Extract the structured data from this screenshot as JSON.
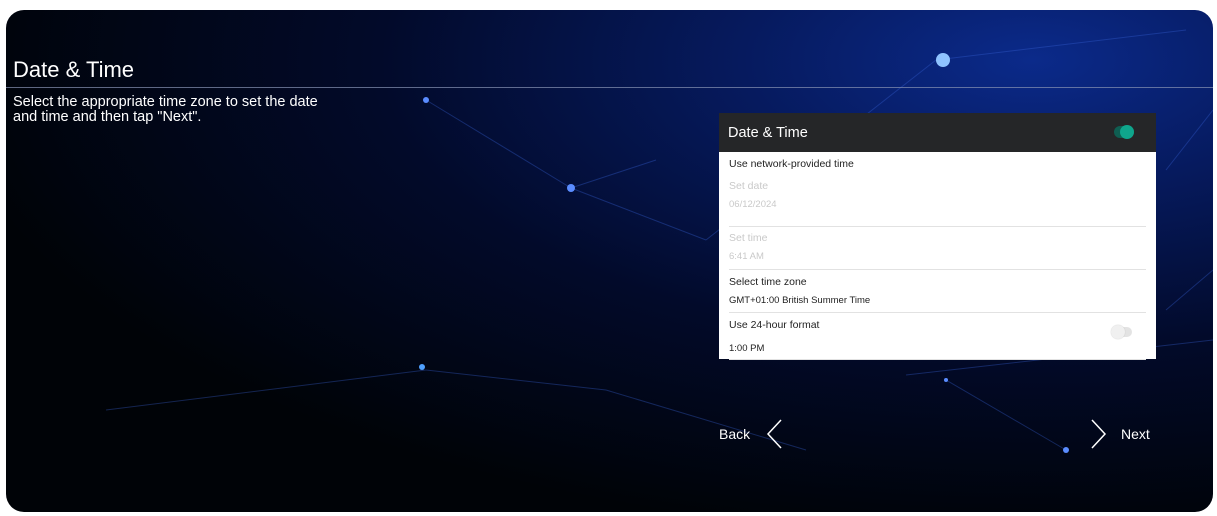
{
  "page": {
    "title": "Date & Time",
    "instructions": "Select the appropriate time zone to set the date and time and then tap \"Next\"."
  },
  "panel": {
    "title": "Date & Time",
    "header_toggle_on": true,
    "network_time": {
      "label": "Use network-provided time"
    },
    "set_date": {
      "label": "Set date",
      "value": "06/12/2024",
      "enabled": false
    },
    "set_time": {
      "label": "Set time",
      "value": "6:41 AM",
      "enabled": false
    },
    "time_zone": {
      "label": "Select time zone",
      "value": "GMT+01:00 British Summer Time"
    },
    "hour24": {
      "label": "Use 24-hour format",
      "value": "1:00 PM",
      "toggle_on": false
    }
  },
  "nav": {
    "back_label": "Back",
    "next_label": "Next"
  },
  "colors": {
    "accent": "#0fa58c",
    "panel_header": "#252628",
    "background": "#020a2a"
  },
  "icons": {
    "back": "chevron-left-icon",
    "next": "chevron-right-icon"
  }
}
